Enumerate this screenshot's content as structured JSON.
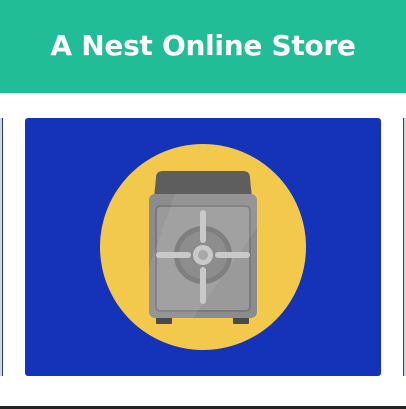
{
  "header": {
    "title": "A Nest Online Store"
  },
  "carousel": {
    "card": {
      "icon": "safe-vault-icon"
    }
  },
  "colors": {
    "header_bg": "#20bd96",
    "card_bg": "#1433b8",
    "circle": "#f2c94c",
    "safe_body": "#8a8a8a",
    "safe_dark": "#5e5e5e"
  }
}
